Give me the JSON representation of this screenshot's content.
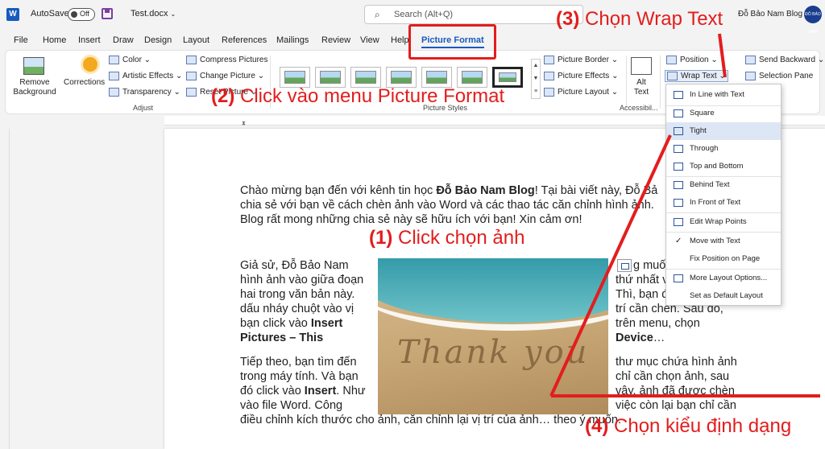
{
  "titlebar": {
    "autosave_label": "AutoSave",
    "autosave_state": "Off",
    "doc_title": "Test.docx",
    "search_placeholder": "Search (Alt+Q)",
    "user_name": "Đỗ Bảo Nam Blog",
    "avatar_text": "ĐỖ BẢO NAM"
  },
  "tabs": [
    "File",
    "Home",
    "Insert",
    "Draw",
    "Design",
    "Layout",
    "References",
    "Mailings",
    "Review",
    "View",
    "Help",
    "Picture Format"
  ],
  "ribbon": {
    "remove_bg": "Remove Background",
    "corrections": "Corrections",
    "color": "Color",
    "artistic": "Artistic Effects",
    "transparency": "Transparency",
    "compress": "Compress Pictures",
    "change_picture": "Change Picture",
    "reset_picture": "Reset Picture",
    "adjust_label": "Adjust",
    "picture_styles_label": "Picture Styles",
    "picture_border": "Picture Border",
    "picture_effects": "Picture Effects",
    "picture_layout": "Picture Layout",
    "alt_text": "Alt Text",
    "accessibility_label": "Accessibil...",
    "position": "Position",
    "wrap_text": "Wrap Text",
    "send_backward": "Send Backward",
    "selection_pane": "Selection Pane"
  },
  "wrap_menu": {
    "items": [
      "In Line with Text",
      "Square",
      "Tight",
      "Through",
      "Top and Bottom",
      "Behind Text",
      "In Front of Text",
      "Edit Wrap Points",
      "Move with Text",
      "Fix Position on Page",
      "More Layout Options...",
      "Set as Default Layout"
    ],
    "highlighted": "Tight",
    "checked": "Move with Text"
  },
  "document": {
    "p1_a": "Chào mừng bạn đến với kênh tin học ",
    "p1_b": "Đỗ Bảo Nam Blog",
    "p1_c": "! Tại bài viết này, Đỗ Bả",
    "p1_line2": "chia sẻ với bạn về cách chèn ảnh vào Word và các thao tác căn chỉnh hình ảnh.",
    "p1_line3": "Blog rất mong những chia sẻ này sẽ hữu ích với bạn! Xin cảm ơn!",
    "left_col1": [
      "Giả sử, Đỗ Bảo Nam",
      "hình ảnh vào giữa đoạn",
      "hai trong văn bản này.",
      "dấu nháy chuột vào vị",
      "bạn click vào "
    ],
    "left_bold1": "Insert",
    "left_bold2": "Pictures – This",
    "right_col1": [
      "g muố",
      "thứ nhất v",
      "Thì, bạn đ",
      "trí cần chèn. Sau đó,",
      "trên menu, chọn"
    ],
    "right_bold1": "Device",
    "right_ellipsis": "…",
    "left_col2": [
      "Tiếp theo, bạn tìm đến",
      "trong máy tính. Và bạn",
      "đó click vào "
    ],
    "left_bold3": "Insert",
    "left_col2_tail": ". Như",
    "left_col2_last": "vào file Word. Công",
    "right_col2": [
      "thư mục chứa hình ảnh",
      "chỉ cần chọn ảnh, sau",
      "vậy, ảnh đã được chèn",
      "việc còn lại bạn chỉ cần"
    ],
    "last_line": "điều chỉnh kích thước cho ảnh, căn chỉnh lại vị trí của ảnh… theo ý muốn.",
    "photo_text": "Thank you"
  },
  "annotations": {
    "a1_num": "(1)",
    "a1_text": " Click chọn ảnh",
    "a2_num": "(2)",
    "a2_text": " Click vào menu Picture Format",
    "a3_num": "(3)",
    "a3_text": " Chọn Wrap Text",
    "a4_num": "(4)",
    "a4_text": " Chọn kiểu định dạng"
  },
  "colors": {
    "annotation": "#e31d1d",
    "accent": "#185abd"
  }
}
